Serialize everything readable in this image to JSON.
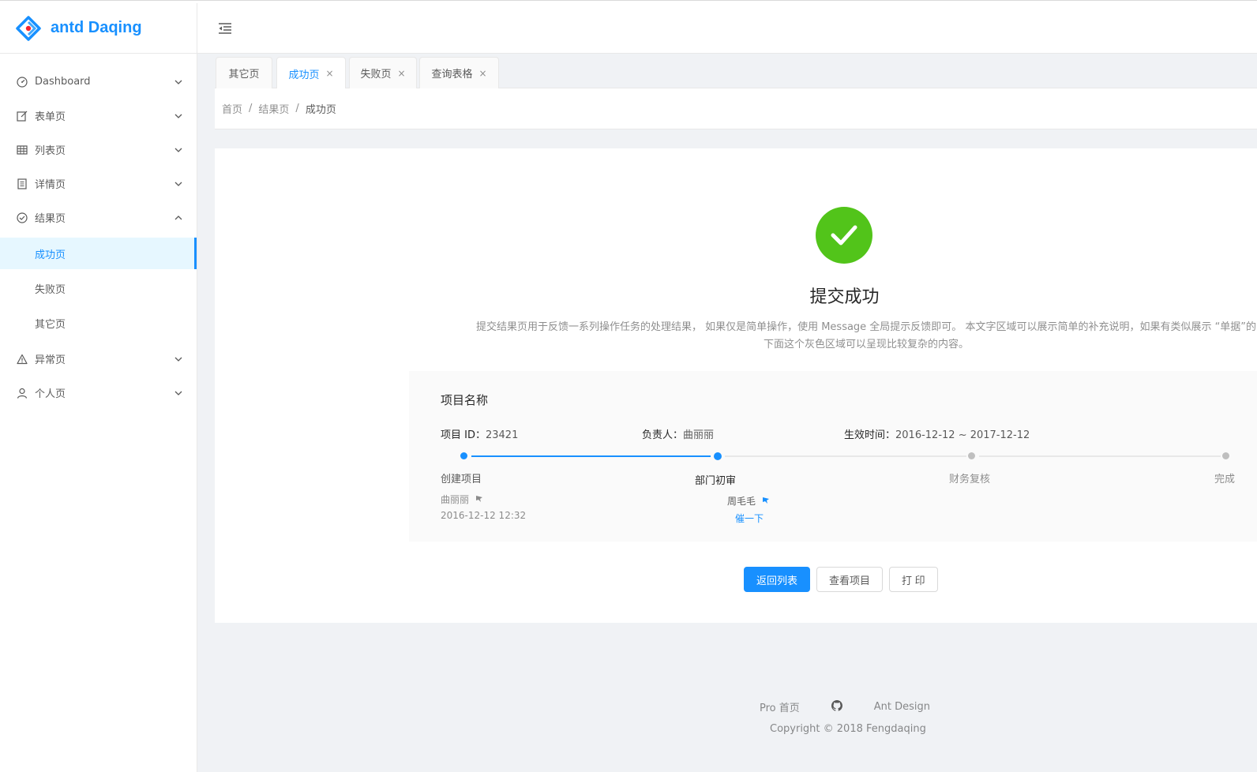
{
  "app": {
    "title": "antd Daqing"
  },
  "sidebar": {
    "items": [
      {
        "label": "Dashboard",
        "icon": "dashboard-icon"
      },
      {
        "label": "表单页",
        "icon": "form-icon"
      },
      {
        "label": "列表页",
        "icon": "table-icon"
      },
      {
        "label": "详情页",
        "icon": "profile-icon"
      },
      {
        "label": "结果页",
        "icon": "check-circle-icon"
      },
      {
        "label": "异常页",
        "icon": "warning-icon"
      },
      {
        "label": "个人页",
        "icon": "user-icon"
      }
    ],
    "result_children": [
      "成功页",
      "失败页",
      "其它页"
    ]
  },
  "tabs": [
    {
      "label": "其它页"
    },
    {
      "label": "成功页"
    },
    {
      "label": "失败页"
    },
    {
      "label": "查询表格"
    }
  ],
  "tab_close": "×",
  "breadcrumb": [
    "首页",
    "结果页",
    "成功页"
  ],
  "breadcrumb_sep": "/",
  "result": {
    "title": "提交成功",
    "desc_line1": "提交结果页用于反馈一系列操作任务的处理结果， 如果仅是简单操作，使用 Message 全局提示反馈即可。 本文字区域可以展示简单的补充说明，如果有类似展示 “单据”的",
    "desc_line2": "下面这个灰色区域可以呈现比较复杂的内容。"
  },
  "extra": {
    "title": "项目名称",
    "project_id_label": "项目 ID：",
    "project_id": "23421",
    "owner_label": "负责人：",
    "owner": "曲丽丽",
    "time_label": "生效时间：",
    "time": "2016-12-12 ~ 2017-12-12",
    "steps": [
      {
        "title": "创建项目",
        "person": "曲丽丽",
        "time": "2016-12-12 12:32"
      },
      {
        "title": "部门初审",
        "person": "周毛毛",
        "action": "催一下"
      },
      {
        "title": "财务复核"
      },
      {
        "title": "完成"
      }
    ]
  },
  "actions": {
    "back": "返回列表",
    "view": "查看项目",
    "print": "打 印"
  },
  "footer": {
    "link1": "Pro 首页",
    "link3": "Ant Design",
    "copyright": "Copyright © 2018 Fengdaqing"
  },
  "colors": {
    "primary": "#1890ff",
    "success": "#52c41a",
    "bg": "#f0f2f5"
  }
}
